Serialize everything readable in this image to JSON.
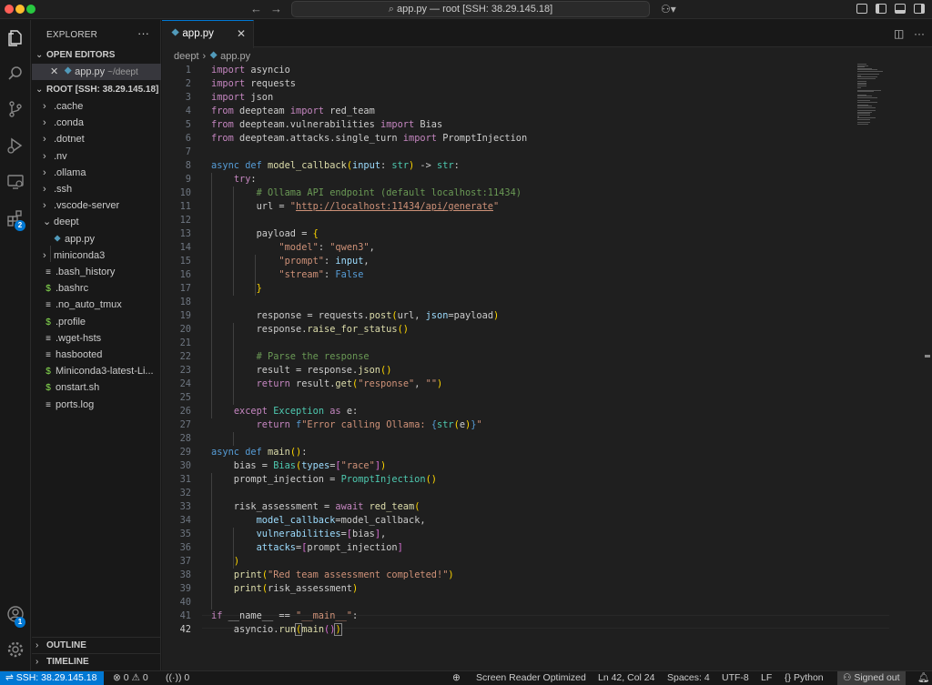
{
  "window": {
    "search_text": "app.py — root [SSH: 38.29.145.18]"
  },
  "activity": {
    "extensions_badge": "2",
    "accounts_badge": "1"
  },
  "sidebar": {
    "title": "EXPLORER",
    "more": "···",
    "open_editors_label": "OPEN EDITORS",
    "open_editor": {
      "name": "app.py",
      "path": "~/deept"
    },
    "root_label": "ROOT [SSH: 38.29.145.18]",
    "tree": [
      {
        "name": ".cache",
        "type": "folder"
      },
      {
        "name": ".conda",
        "type": "folder"
      },
      {
        "name": ".dotnet",
        "type": "folder"
      },
      {
        "name": ".nv",
        "type": "folder"
      },
      {
        "name": ".ollama",
        "type": "folder"
      },
      {
        "name": ".ssh",
        "type": "folder"
      },
      {
        "name": ".vscode-server",
        "type": "folder"
      },
      {
        "name": "deept",
        "type": "folder-open"
      },
      {
        "name": "app.py",
        "type": "python"
      },
      {
        "name": "miniconda3",
        "type": "folder"
      },
      {
        "name": ".bash_history",
        "type": "text"
      },
      {
        "name": ".bashrc",
        "type": "shell"
      },
      {
        "name": ".no_auto_tmux",
        "type": "text"
      },
      {
        "name": ".profile",
        "type": "shell"
      },
      {
        "name": ".wget-hsts",
        "type": "text"
      },
      {
        "name": "hasbooted",
        "type": "text"
      },
      {
        "name": "Miniconda3-latest-Li...",
        "type": "shell"
      },
      {
        "name": "onstart.sh",
        "type": "shell"
      },
      {
        "name": "ports.log",
        "type": "text"
      }
    ],
    "outline_label": "OUTLINE",
    "timeline_label": "TIMELINE"
  },
  "editor": {
    "tab_label": "app.py",
    "tab_close": "✕",
    "breadcrumb": {
      "folder": "deept",
      "file": "app.py"
    },
    "active_line": 42,
    "line_numbers": [
      "1",
      "2",
      "3",
      "4",
      "5",
      "6",
      "7",
      "8",
      "9",
      "10",
      "11",
      "12",
      "13",
      "14",
      "15",
      "16",
      "17",
      "18",
      "19",
      "20",
      "21",
      "22",
      "23",
      "24",
      "25",
      "26",
      "27",
      "28",
      "29",
      "30",
      "31",
      "32",
      "33",
      "34",
      "35",
      "36",
      "37",
      "38",
      "39",
      "40",
      "41",
      "42"
    ]
  },
  "status": {
    "remote": "SSH: 38.29.145.18",
    "errors": "0",
    "warnings": "0",
    "ports": "0",
    "screen_reader": "Screen Reader Optimized",
    "cursor": "Ln 42, Col 24",
    "spaces": "Spaces: 4",
    "encoding": "UTF-8",
    "eol": "LF",
    "language": "Python",
    "account": "Signed out"
  }
}
